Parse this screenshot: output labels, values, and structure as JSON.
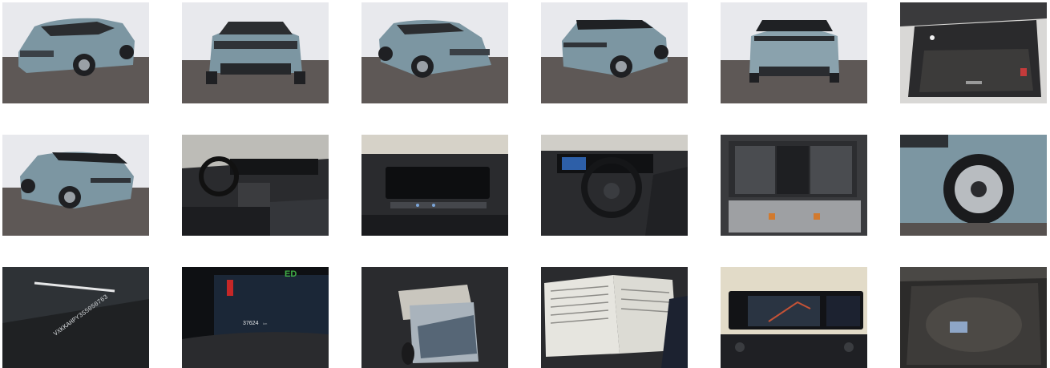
{
  "gallery": {
    "photos": [
      {
        "icon": "car-front-left-icon"
      },
      {
        "icon": "car-front-icon"
      },
      {
        "icon": "car-front-right-icon"
      },
      {
        "icon": "car-rear-right-icon"
      },
      {
        "icon": "car-rear-icon"
      },
      {
        "icon": "trunk-icon"
      },
      {
        "icon": "car-rear-left-icon"
      },
      {
        "icon": "dashboard-icon"
      },
      {
        "icon": "infotainment-icon"
      },
      {
        "icon": "steering-wheel-icon"
      },
      {
        "icon": "rear-seats-icon"
      },
      {
        "icon": "wheel-icon"
      },
      {
        "icon": "vin-plate-icon"
      },
      {
        "icon": "odometer-icon"
      },
      {
        "icon": "documents-keys-icon"
      },
      {
        "icon": "manual-icon"
      },
      {
        "icon": "navigation-screen-icon"
      },
      {
        "icon": "spare-compartment-icon"
      }
    ],
    "vin_text": "VXKKAHPY3S5050763",
    "odometer_reading": "37624",
    "odometer_unit": "km",
    "ed_label": "ED",
    "colors": {
      "car_body": "#7e98a4",
      "studio_wall": "#e9eaee",
      "studio_floor": "#5f5a58",
      "interior_dark": "#2a2b2e"
    }
  }
}
